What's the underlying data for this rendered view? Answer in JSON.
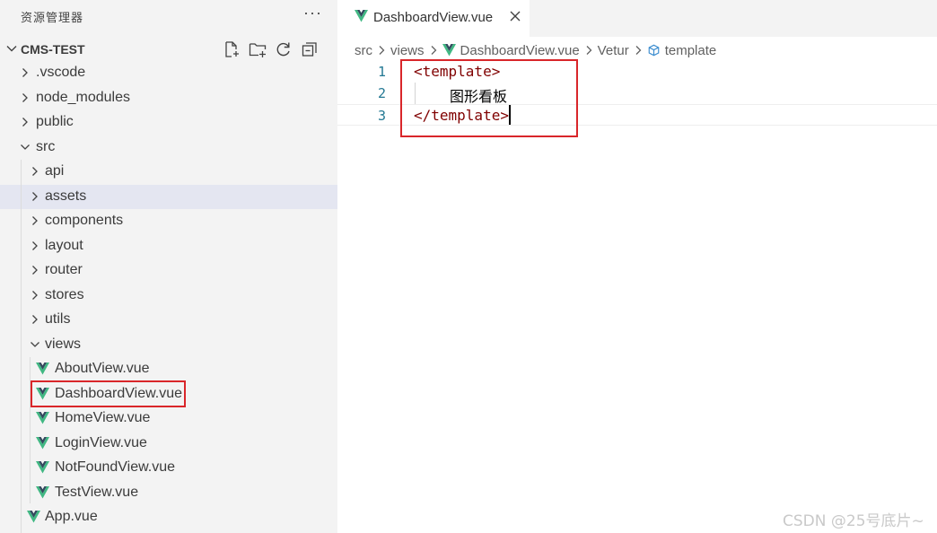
{
  "sidebar": {
    "title": "资源管理器",
    "more": "···",
    "project": "CMS-TEST",
    "tree": [
      {
        "label": ".vscode",
        "kind": "folder",
        "open": false,
        "depth": 0
      },
      {
        "label": "node_modules",
        "kind": "folder",
        "open": false,
        "depth": 0
      },
      {
        "label": "public",
        "kind": "folder",
        "open": false,
        "depth": 0
      },
      {
        "label": "src",
        "kind": "folder",
        "open": true,
        "depth": 0
      },
      {
        "label": "api",
        "kind": "folder",
        "open": false,
        "depth": 1
      },
      {
        "label": "assets",
        "kind": "folder",
        "open": false,
        "depth": 1,
        "selected": true
      },
      {
        "label": "components",
        "kind": "folder",
        "open": false,
        "depth": 1
      },
      {
        "label": "layout",
        "kind": "folder",
        "open": false,
        "depth": 1
      },
      {
        "label": "router",
        "kind": "folder",
        "open": false,
        "depth": 1
      },
      {
        "label": "stores",
        "kind": "folder",
        "open": false,
        "depth": 1
      },
      {
        "label": "utils",
        "kind": "folder",
        "open": false,
        "depth": 1
      },
      {
        "label": "views",
        "kind": "folder",
        "open": true,
        "depth": 1
      },
      {
        "label": "AboutView.vue",
        "kind": "vue",
        "depth": 2
      },
      {
        "label": "DashboardView.vue",
        "kind": "vue",
        "depth": 2
      },
      {
        "label": "HomeView.vue",
        "kind": "vue",
        "depth": 2
      },
      {
        "label": "LoginView.vue",
        "kind": "vue",
        "depth": 2
      },
      {
        "label": "NotFoundView.vue",
        "kind": "vue",
        "depth": 2
      },
      {
        "label": "TestView.vue",
        "kind": "vue",
        "depth": 2
      },
      {
        "label": "App.vue",
        "kind": "vue",
        "depth": 1
      }
    ]
  },
  "editor": {
    "tab": {
      "label": "DashboardView.vue"
    },
    "breadcrumb": {
      "p1": "src",
      "p2": "views",
      "p3": "DashboardView.vue",
      "p4": "Vetur",
      "p5": "template"
    },
    "lines": [
      {
        "num": "1",
        "text": "<template>"
      },
      {
        "num": "2",
        "text": "图形看板"
      },
      {
        "num": "3",
        "text": "</template>"
      }
    ]
  },
  "watermark": "CSDN @25号底片~",
  "colors": {
    "vue_green": "#41b883",
    "vue_dark": "#34495e",
    "accent_red": "#d9262a",
    "tag": "#800000",
    "line_number": "#237893"
  }
}
